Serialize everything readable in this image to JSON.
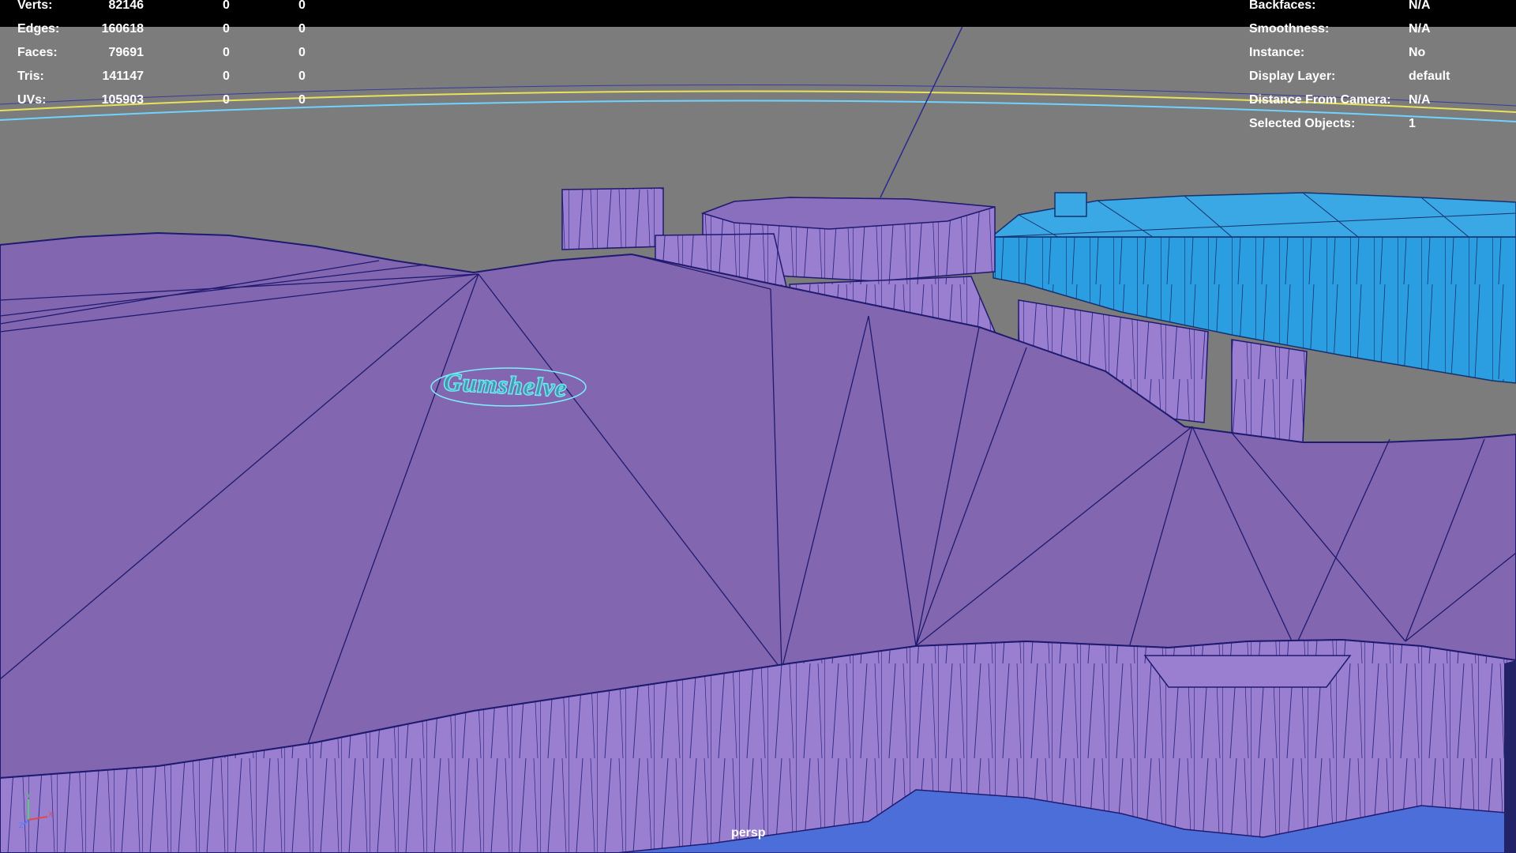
{
  "stats": {
    "rows": [
      {
        "label": "Verts:",
        "v1": "82146",
        "v2": "0",
        "v3": "0"
      },
      {
        "label": "Edges:",
        "v1": "160618",
        "v2": "0",
        "v3": "0"
      },
      {
        "label": "Faces:",
        "v1": "79691",
        "v2": "0",
        "v3": "0"
      },
      {
        "label": "Tris:",
        "v1": "141147",
        "v2": "0",
        "v3": "0"
      },
      {
        "label": "UVs:",
        "v1": "105903",
        "v2": "0",
        "v3": "0"
      }
    ]
  },
  "object_info": {
    "rows": [
      {
        "label": "Backfaces:",
        "value": "N/A"
      },
      {
        "label": "Smoothness:",
        "value": "N/A"
      },
      {
        "label": "Instance:",
        "value": "No"
      },
      {
        "label": "Display Layer:",
        "value": "default"
      },
      {
        "label": "Distance From Camera:",
        "value": "N/A"
      },
      {
        "label": "Selected Objects:",
        "value": "1"
      }
    ]
  },
  "camera": {
    "name": "persp"
  },
  "axis_gizmo": {
    "x_label": "X",
    "y_label": "Y",
    "z_label": "Z"
  },
  "colors": {
    "background": "#7c7c7c",
    "terrain_top": "#8366b0",
    "terrain_side": "#9a7fd0",
    "water": "#2a9ee0",
    "wire": "#1e1a70",
    "selection": "#7ef0ff"
  }
}
